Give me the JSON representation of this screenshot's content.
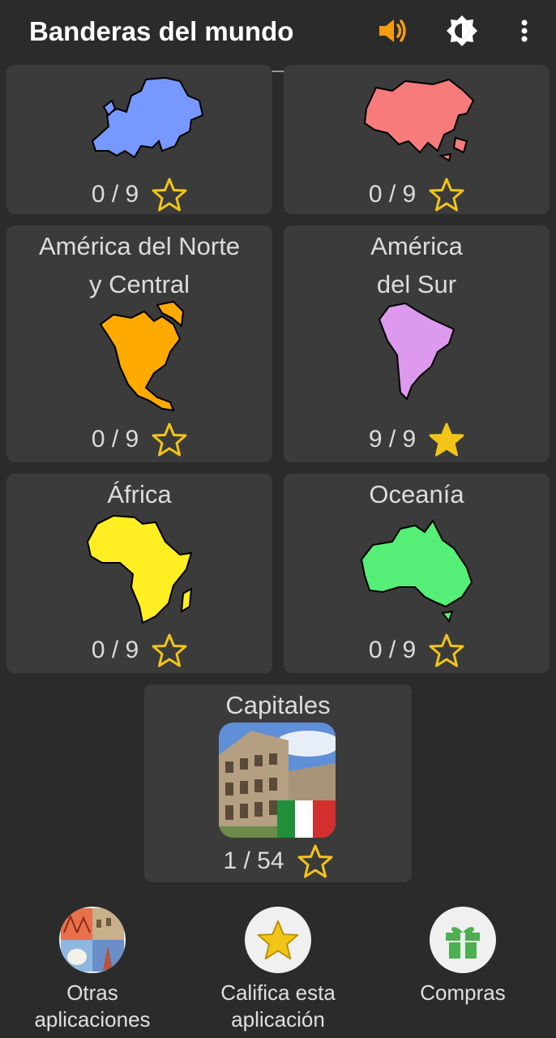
{
  "app_bar": {
    "title": "Banderas del mundo",
    "sound_icon": "volume-icon",
    "brightness_icon": "brightness-icon",
    "menu_icon": "more-vert-icon"
  },
  "continents": [
    {
      "name": "",
      "score": "0 / 9",
      "completed": false,
      "map_color": "#7799ff",
      "map_icon": "europe-map"
    },
    {
      "name": "",
      "score": "0 / 9",
      "completed": false,
      "map_color": "#f77b7b",
      "map_icon": "asia-map"
    },
    {
      "name_line1": "América del Norte",
      "name_line2": "y Central",
      "score": "0 / 9",
      "completed": false,
      "map_color": "#ffaa00",
      "map_icon": "north-america-map"
    },
    {
      "name_line1": "América",
      "name_line2": "del Sur",
      "score": "9 / 9",
      "completed": true,
      "map_color": "#dd99ee",
      "map_icon": "south-america-map"
    },
    {
      "name": "África",
      "score": "0 / 9",
      "completed": false,
      "map_color": "#ffee22",
      "map_icon": "africa-map"
    },
    {
      "name": "Oceanía",
      "score": "0 / 9",
      "completed": false,
      "map_color": "#55ee77",
      "map_icon": "australia-map"
    }
  ],
  "capitals": {
    "title": "Capitales",
    "score": "1 / 54",
    "completed": false
  },
  "bottom_bar": {
    "other_apps_line1": "Otras",
    "other_apps_line2": "aplicaciones",
    "rate_line1": "Califica esta",
    "rate_line2": "aplicación",
    "purchases": "Compras"
  },
  "colors": {
    "background": "#2b2b2b",
    "card": "#3b3b3b",
    "star_gold": "#f2c418",
    "sound_orange": "#f39c12",
    "gift_green": "#4caf50"
  }
}
